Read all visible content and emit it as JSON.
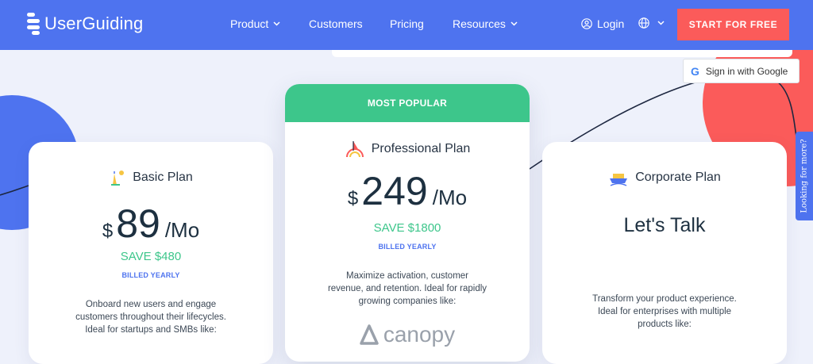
{
  "nav": {
    "brand": "UserGuiding",
    "items": [
      {
        "label": "Product",
        "has_dropdown": true
      },
      {
        "label": "Customers",
        "has_dropdown": false
      },
      {
        "label": "Pricing",
        "has_dropdown": false
      },
      {
        "label": "Resources",
        "has_dropdown": true
      }
    ],
    "login": "Login",
    "cta": "START FOR FREE"
  },
  "google_signin": "Sign in with Google",
  "side_tab": "Looking for more?",
  "colors": {
    "brand_blue": "#4e73ef",
    "cta_red": "#fb5b5a",
    "popular_green": "#3dc68b"
  },
  "plans": {
    "basic": {
      "name": "Basic Plan",
      "currency": "$",
      "price": "89",
      "period": "/Mo",
      "save": "SAVE $480",
      "billed": "BILLED YEARLY",
      "desc_lines": [
        "Onboard new users and engage",
        "customers throughout their lifecycles.",
        "Ideal for startups and SMBs like:"
      ]
    },
    "pro": {
      "ribbon": "MOST POPULAR",
      "name": "Professional Plan",
      "currency": "$",
      "price": "249",
      "period": "/Mo",
      "save": "SAVE $1800",
      "billed": "BILLED YEARLY",
      "desc_lines": [
        "Maximize activation, customer",
        "revenue, and retention. Ideal for rapidly",
        "growing companies like:"
      ],
      "customer_logo": "canopy"
    },
    "corp": {
      "name": "Corporate Plan",
      "price_text": "Let's Talk",
      "desc_lines": [
        "Transform your product experience.",
        "Ideal for enterprises with multiple",
        "products like:"
      ]
    }
  }
}
